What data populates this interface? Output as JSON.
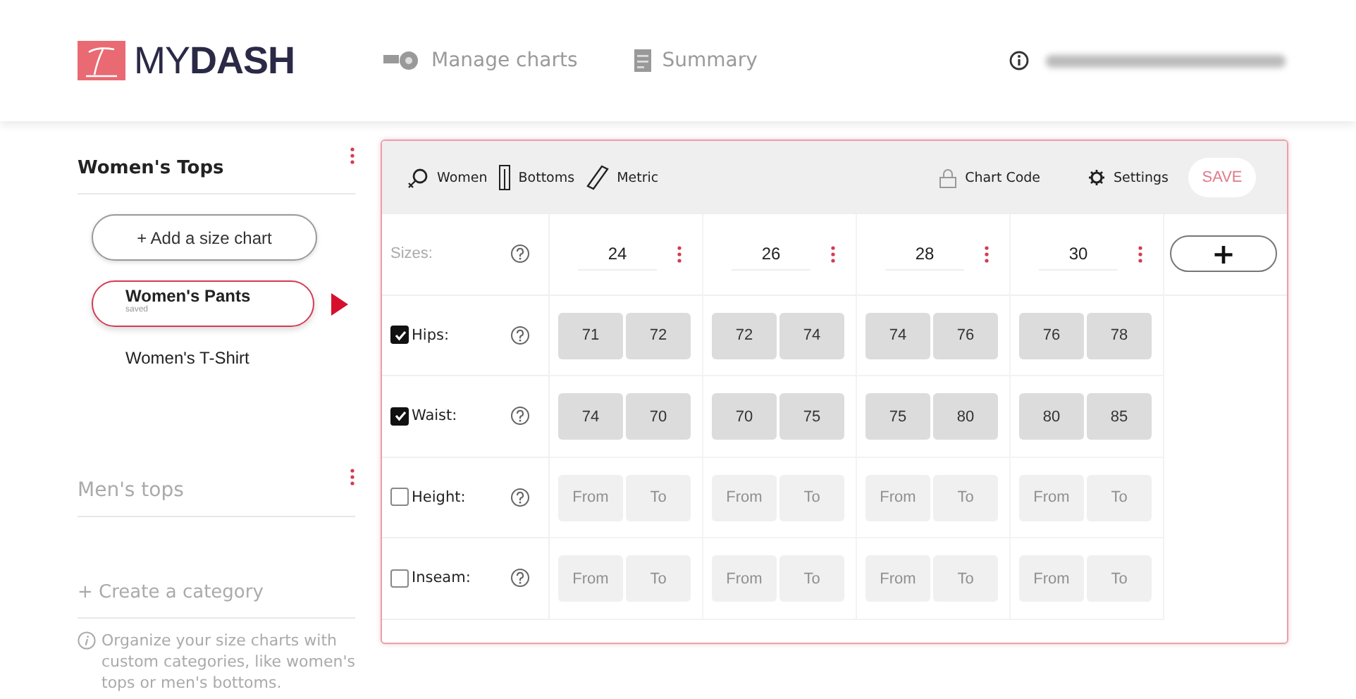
{
  "header": {
    "logo": "MY**DASH**",
    "nav": [
      {
        "label": "Manage charts",
        "kind": "charts"
      },
      {
        "label": "Summary",
        "kind": "summary"
      }
    ]
  },
  "sidebar": {
    "categories": [
      {
        "title": "Women's Tops",
        "expanded": true,
        "add_button": "+ Add a size chart",
        "charts": [
          {
            "name": "Women's Pants",
            "status": "saved",
            "selected": true
          },
          {
            "name": "Women's T-Shirt",
            "selected": false
          }
        ]
      },
      {
        "title": "Men's tops",
        "expanded": false
      }
    ],
    "create_link": "+ Create a category",
    "hint": "Organize your size charts with custom categories, like women's tops or men's bottoms."
  },
  "chart": {
    "toolbar": [
      {
        "label": "Women",
        "kind": "gender"
      },
      {
        "label": "Bottoms",
        "kind": "bottoms"
      },
      {
        "label": "Metric",
        "kind": "ruler"
      }
    ],
    "actions": [
      {
        "label": "Chart Code",
        "kind": "lock"
      },
      {
        "label": "Settings",
        "kind": "gear"
      }
    ],
    "save": {
      "label": "SAVE",
      "disabled": true
    },
    "sizes_label": "Sizes:",
    "sizes": [
      "24",
      "26",
      "28",
      "30"
    ],
    "add_size": "+",
    "rows": [
      {
        "label": "Hips:",
        "checked": true,
        "cells": [
          {
            "value": "71"
          },
          {
            "value": "72"
          },
          {
            "value": "72"
          },
          {
            "value": "74"
          },
          {
            "value": "74"
          },
          {
            "value": "76"
          },
          {
            "value": "76"
          },
          {
            "value": "78"
          }
        ]
      },
      {
        "label": "Waist:",
        "checked": true,
        "cells": [
          {
            "value": "74"
          },
          {
            "value": "70"
          },
          {
            "value": "70"
          },
          {
            "value": "75"
          },
          {
            "value": "75"
          },
          {
            "value": "80"
          },
          {
            "value": "80"
          },
          {
            "value": "85"
          }
        ]
      },
      {
        "label": "Height:",
        "checked": false,
        "cells": [
          {
            "placeholder": "From"
          },
          {
            "placeholder": "To"
          },
          {
            "placeholder": "From"
          },
          {
            "placeholder": "To"
          },
          {
            "placeholder": "From"
          },
          {
            "placeholder": "To"
          },
          {
            "placeholder": "From"
          },
          {
            "placeholder": "To"
          }
        ]
      },
      {
        "label": "Inseam:",
        "checked": false,
        "cells": [
          {
            "placeholder": "From"
          },
          {
            "placeholder": "To"
          },
          {
            "placeholder": "From"
          },
          {
            "placeholder": "To"
          },
          {
            "placeholder": "From"
          },
          {
            "placeholder": "To"
          },
          {
            "placeholder": "From"
          },
          {
            "placeholder": "To"
          }
        ]
      }
    ]
  }
}
